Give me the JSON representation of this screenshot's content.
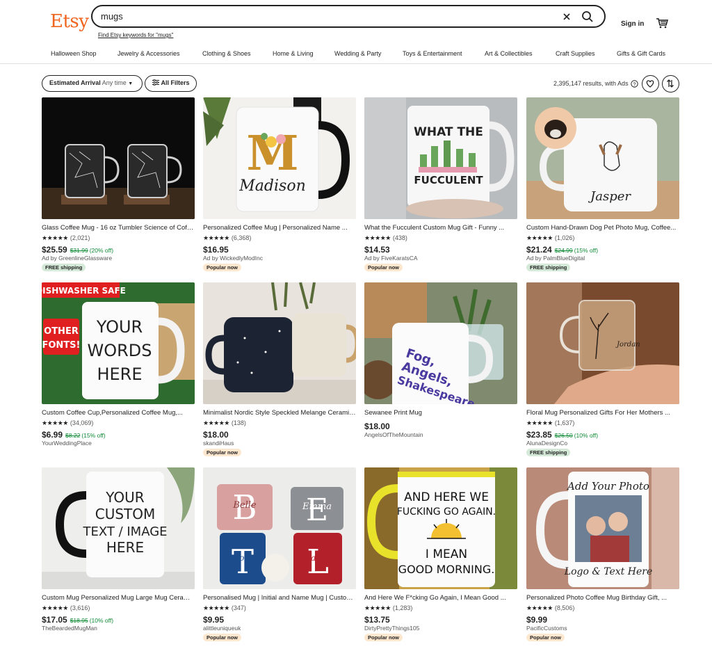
{
  "header": {
    "logo": "Etsy",
    "search_value": "mugs",
    "keyword_link": "Find Etsy keywords for \"mugs\"",
    "signin": "Sign in"
  },
  "categories": [
    "Halloween Shop",
    "Jewelry & Accessories",
    "Clothing & Shoes",
    "Home & Living",
    "Wedding & Party",
    "Toys & Entertainment",
    "Art & Collectibles",
    "Craft Supplies",
    "Gifts & Gift Cards"
  ],
  "filters": {
    "arrival_label": "Estimated Arrival",
    "arrival_value": "Any time",
    "all_filters": "All Filters",
    "results": "2,395,147 results, with Ads"
  },
  "colors": {
    "brand": "#f1641e",
    "sale": "#0e8a35",
    "free_badge": "#d4e9d7",
    "popular_badge": "#fde8cf"
  },
  "products": [
    {
      "title": "Glass Coffee Mug - 16 oz Tumbler Science of Coffee...",
      "stars": "★★★★★",
      "count": "(2,021)",
      "price": "$25.59",
      "orig": "$31.99",
      "disc": "(20% off)",
      "seller": "Ad by GreenlineGlassware",
      "badge": "FREE shipping"
    },
    {
      "title": "Personalized Coffee Mug | Personalized Name ...",
      "stars": "★★★★★",
      "count": "(6,368)",
      "price": "$16.95",
      "orig": "",
      "disc": "",
      "seller": "Ad by WickedlyModInc",
      "badge": "Popular now"
    },
    {
      "title": "What the Fucculent Custom Mug Gift - Funny ...",
      "stars": "★★★★★",
      "count": "(438)",
      "price": "$14.53",
      "orig": "",
      "disc": "",
      "seller": "Ad by FiveKaratsCA",
      "badge": "Popular now"
    },
    {
      "title": "Custom Hand-Drawn Dog Pet Photo Mug, Coffee...",
      "stars": "★★★★★",
      "count": "(1,026)",
      "price": "$21.24",
      "orig": "$24.99",
      "disc": "(15% off)",
      "seller": "Ad by PalmBlueDigital",
      "badge": "FREE shipping"
    },
    {
      "title": "Custom Coffee Cup,Personalized Coffee Mug,...",
      "stars": "★★★★★",
      "count": "(34,069)",
      "price": "$6.99",
      "orig": "$8.22",
      "disc": "(15% off)",
      "seller": "YourWeddingPlace",
      "badge": ""
    },
    {
      "title": "Minimalist Nordic Style Speckled Melange Ceramic...",
      "stars": "★★★★★",
      "count": "(138)",
      "price": "$18.00",
      "orig": "",
      "disc": "",
      "seller": "skandiHaus",
      "badge": "Popular now"
    },
    {
      "title": "Sewanee Print Mug",
      "stars": "",
      "count": "",
      "price": "$18.00",
      "orig": "",
      "disc": "",
      "seller": "AngelsOfTheMountain",
      "badge": ""
    },
    {
      "title": "Floral Mug Personalized Gifts For Her Mothers ...",
      "stars": "★★★★★",
      "count": "(1,637)",
      "price": "$23.85",
      "orig": "$26.50",
      "disc": "(10% off)",
      "seller": "AlunaDesignCo",
      "badge": "FREE shipping"
    },
    {
      "title": "Custom Mug Personalized Mug Large Mug Ceramic...",
      "stars": "★★★★★",
      "count": "(3,616)",
      "price": "$17.05",
      "orig": "$18.95",
      "disc": "(10% off)",
      "seller": "TheBeardedMugMan",
      "badge": ""
    },
    {
      "title": "Personalised Mug | Initial and Name Mug | Custom...",
      "stars": "★★★★★",
      "count": "(347)",
      "price": "$9.95",
      "orig": "",
      "disc": "",
      "seller": "alittleuniqueuk",
      "badge": "Popular now"
    },
    {
      "title": "And Here We F*cking Go Again, I Mean Good ...",
      "stars": "★★★★★",
      "count": "(1,283)",
      "price": "$13.75",
      "orig": "",
      "disc": "",
      "seller": "DirtyPrettyThings105",
      "badge": "Popular now"
    },
    {
      "title": "Personalized Photo Coffee Mug Birthday Gift, ...",
      "stars": "★★★★★",
      "count": "(8,506)",
      "price": "$9.99",
      "orig": "",
      "disc": "",
      "seller": "PacificCustoms",
      "badge": "Popular now"
    }
  ],
  "mug_texts": {
    "m_letter": "M",
    "madison": "Madison",
    "fucculent_1": "WHAT THE",
    "fucculent_2": "FUCCULENT",
    "jasper": "Jasper",
    "dishwasher": "DISHWASHER SAFE",
    "other_fonts_1": "OTHER",
    "other_fonts_2": "FONTS!",
    "your_words_1": "YOUR",
    "your_words_2": "WORDS",
    "your_words_3": "HERE",
    "sewanee_1": "Fog,",
    "sewanee_2": "Angels,",
    "sewanee_3": "Shakespeare",
    "floral_name": "Jordan",
    "custom_1": "YOUR",
    "custom_2": "CUSTOM",
    "custom_3": "TEXT / IMAGE",
    "custom_4": "HERE",
    "initial_1": "B",
    "initial_1_name": "Belle",
    "initial_2": "E",
    "initial_2_name": "Emma",
    "initial_3": "T",
    "initial_3_name": "Tori",
    "initial_4": "L",
    "initial_4_name": "Laura",
    "again_1": "AND HERE WE",
    "again_2": "FUCKING GO AGAIN.",
    "again_3": "I MEAN",
    "again_4": "GOOD MORNING.",
    "photo_1": "Add Your Photo",
    "photo_2": "Logo & Text Here"
  }
}
